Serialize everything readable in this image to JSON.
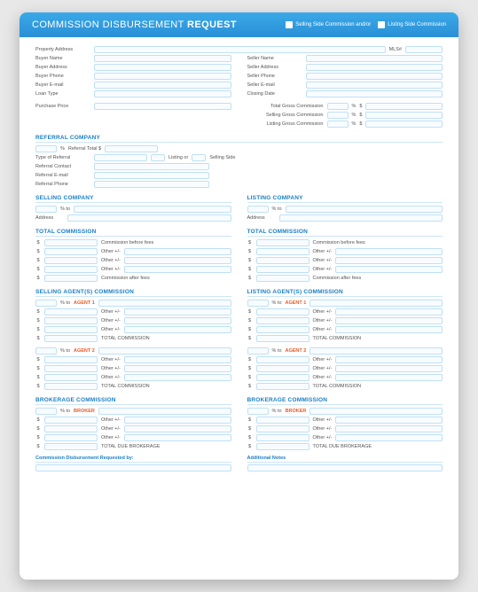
{
  "header": {
    "title_prefix": "COMMISSION DISBURSEMENT",
    "title_bold": "REQUEST",
    "check1": "Selling Side Commission and/or",
    "check2": "Listing Side Commission"
  },
  "top": {
    "property_address": "Property Address",
    "mls": "MLS#",
    "buyer_name": "Buyer Name",
    "buyer_address": "Buyer Address",
    "buyer_phone": "Buyer Phone",
    "buyer_email": "Buyer E-mail",
    "loan_type": "Loan Type",
    "seller_name": "Seller Name",
    "seller_address": "Seller Address",
    "seller_phone": "Seller Phone",
    "seller_email": "Seller E-mail",
    "closing_date": "Closing Date",
    "purchase_price": "Purchase Price",
    "total_gross": "Total Gross Commission",
    "selling_gross": "Selling Gross Commission",
    "listing_gross": "Listing Gross Commission",
    "pct": "%",
    "dollar": "$"
  },
  "referral": {
    "title": "REFERRAL COMPANY",
    "pct": "%",
    "total": "Referral Total $",
    "type": "Type of Referral",
    "listing_or": "Listing or",
    "selling_side": "Selling Side",
    "contact": "Referral Contact",
    "email": "Referral E-mail",
    "phone": "Referral Phone"
  },
  "selling_company": {
    "title": "SELLING COMPANY",
    "pct_to": "% to",
    "address": "Address"
  },
  "listing_company": {
    "title": "LISTING COMPANY",
    "pct_to": "% to",
    "address": "Address"
  },
  "total_commission": {
    "title": "TOTAL COMMISSION",
    "before": "Commission before fees",
    "other": "Other +/-",
    "after": "Commission after fees",
    "dollar": "$"
  },
  "agents": {
    "selling_title": "SELLING AGENT(S) COMMISSION",
    "listing_title": "LISTING AGENT(S) COMMISSION",
    "pct_to": "% to",
    "agent1": "AGENT 1",
    "agent2": "AGENT 2",
    "other": "Other +/-",
    "total": "TOTAL COMMISSION",
    "dollar": "$"
  },
  "brokerage": {
    "title": "BROKERAGE COMMISSION",
    "pct_to": "% to",
    "broker": "BROKER",
    "other": "Other +/-",
    "total_due": "TOTAL DUE BROKERAGE",
    "dollar": "$"
  },
  "footer": {
    "requested_by": "Commission Disbursement Requested by:",
    "notes": "Additional Notes"
  }
}
